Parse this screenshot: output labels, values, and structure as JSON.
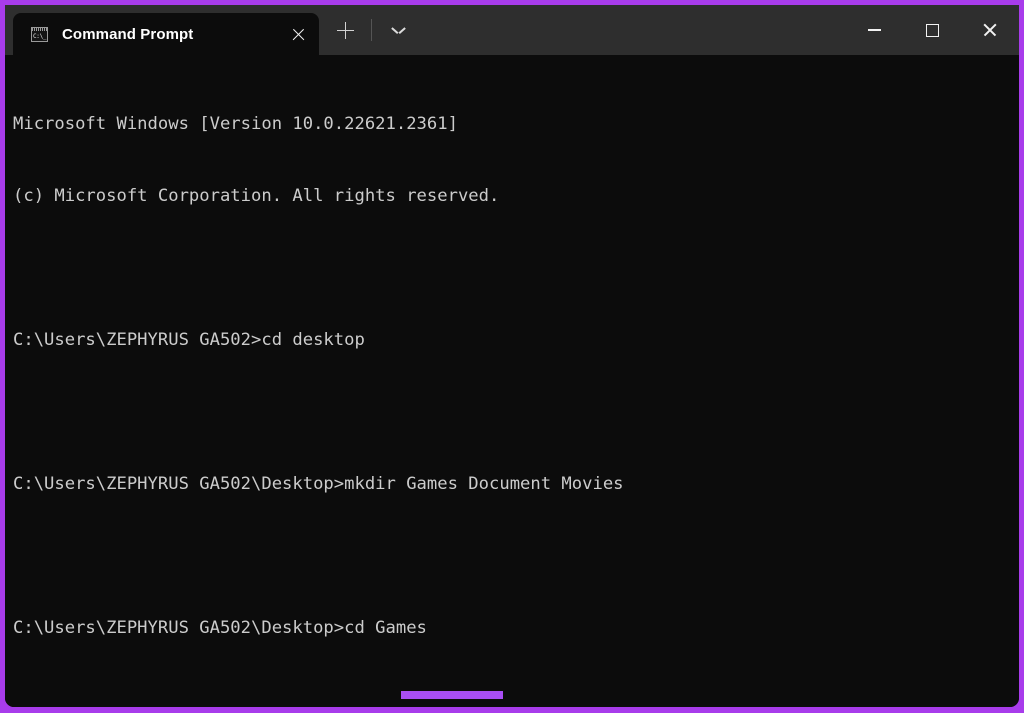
{
  "window": {
    "accent_color": "#a83ceb",
    "titlebar_color": "#2e2e2e",
    "terminal_bg": "#0c0c0c",
    "terminal_fg": "#cccccc",
    "controls": {
      "minimize_label": "Minimize",
      "maximize_label": "Maximize",
      "close_label": "Close"
    }
  },
  "tabs": [
    {
      "title": "Command Prompt",
      "icon": "command-prompt-icon",
      "icon_text": "C:\\_",
      "active": true,
      "close_label": "Close tab"
    }
  ],
  "tab_actions": {
    "new_tab_label": "New tab",
    "new_tab_icon": "plus-icon",
    "dropdown_label": "Open new tab dropdown",
    "dropdown_icon": "chevron-down-icon"
  },
  "terminal": {
    "lines": [
      "Microsoft Windows [Version 10.0.22621.2361]",
      "(c) Microsoft Corporation. All rights reserved.",
      "",
      "C:\\Users\\ZEPHYRUS GA502>cd desktop",
      "",
      "C:\\Users\\ZEPHYRUS GA502\\Desktop>mkdir Games Document Movies",
      "",
      "C:\\Users\\ZEPHYRUS GA502\\Desktop>cd Games"
    ],
    "version_string": "10.0.22621.2361",
    "prompt_user_path": "C:\\Users\\ZEPHYRUS GA502",
    "prompt_desktop_path": "C:\\Users\\ZEPHYRUS GA502\\Desktop",
    "commands": [
      "cd desktop",
      "mkdir Games Document Movies",
      "cd Games"
    ],
    "highlight": {
      "target_text": "cd Games",
      "color": "#a94ef5"
    }
  }
}
